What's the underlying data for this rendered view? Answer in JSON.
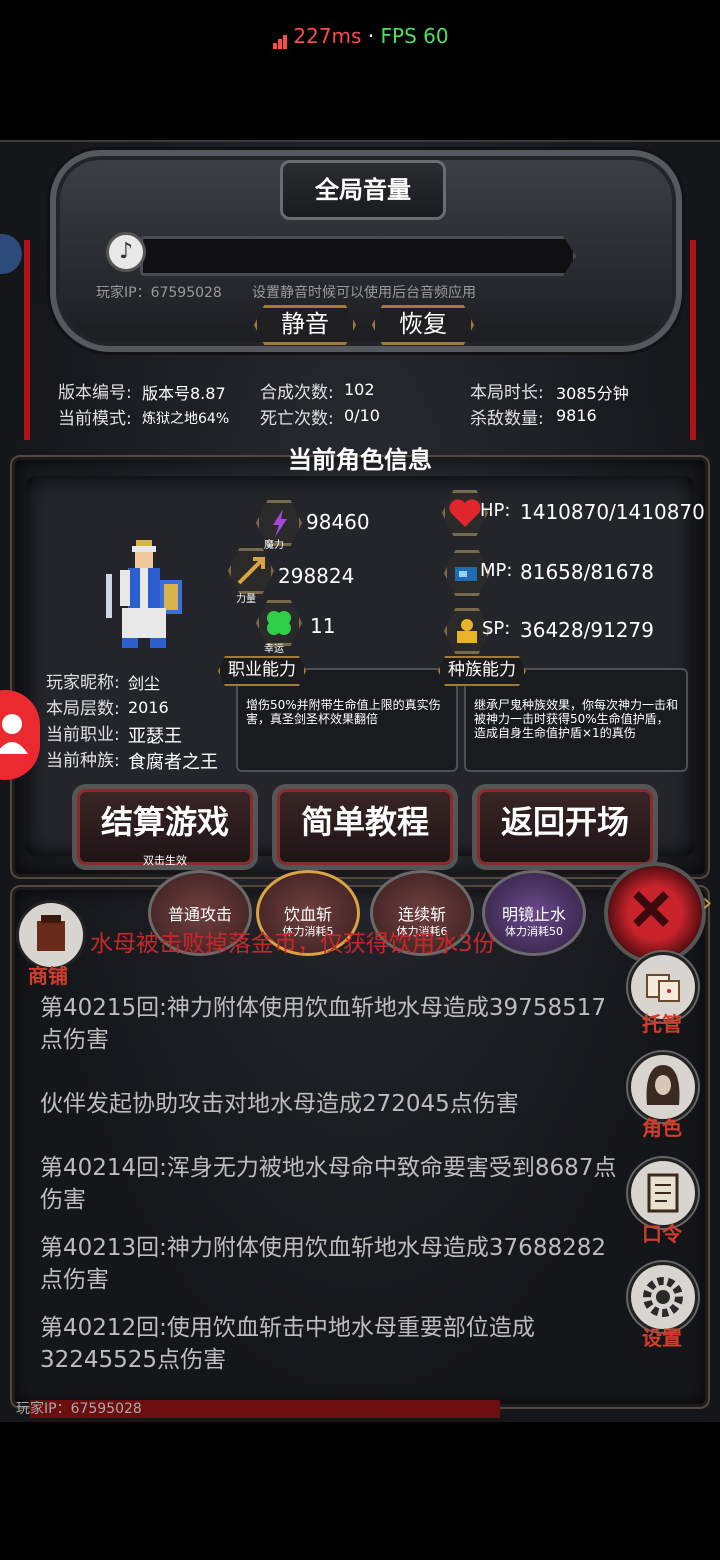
{
  "status_bar": {
    "ping": "227ms",
    "separator": " · ",
    "fps": "FPS 60"
  },
  "volume_panel": {
    "title": "全局音量",
    "player_ip": "玩家IP：67595028",
    "hint": "设置静音时候可以使用后台音频应用",
    "mute_label": "静音",
    "restore_label": "恢复",
    "speaker_icon": "speaker-icon"
  },
  "game_info": {
    "version_label": "版本编号:",
    "version_value": "版本号8.87",
    "mode_label": "当前模式:",
    "mode_value": "炼狱之地64%",
    "synth_label": "合成次数:",
    "synth_value": "102",
    "death_label": "死亡次数:",
    "death_value": "0/10",
    "duration_label": "本局时长:",
    "duration_value": "3085分钟",
    "kills_label": "杀敌数量:",
    "kills_value": "9816"
  },
  "character": {
    "section_title": "当前角色信息",
    "magic_value": "98460",
    "magic_label": "魔力",
    "strength_value": "298824",
    "strength_label": "力量",
    "luck_value": "11",
    "luck_label": "幸运",
    "hp_label": "HP:",
    "hp_value": "1410870/1410870",
    "mp_label": "MP:",
    "mp_value": "81658/81678",
    "sp_label": "SP:",
    "sp_value": "36428/91279",
    "nickname_label": "玩家昵称:",
    "nickname_value": "剑尘",
    "floor_label": "本局层数:",
    "floor_value": "2016",
    "class_label": "当前职业:",
    "class_value": "亚瑟王",
    "race_label": "当前种族:",
    "race_value": "食腐者之王",
    "class_ability_tag": "职业能力",
    "class_ability_text": "增伤50%并附带生命值上限的真实伤害，真圣剑圣杯效果翻倍",
    "race_ability_tag": "种族能力",
    "race_ability_text": "继承尸鬼种族效果，你每次神力一击和被神力一击时获得50%生命值护盾，造成自身生命值护盾×1的真伤"
  },
  "actions": {
    "settle_label": "结算游戏",
    "settle_sub": "双击生效",
    "tutorial_label": "简单教程",
    "return_label": "返回开场"
  },
  "skills": [
    {
      "name": "普通攻击",
      "cost": ""
    },
    {
      "name": "饮血斩",
      "cost": "体力消耗5"
    },
    {
      "name": "连续斩",
      "cost": "体力消耗6"
    },
    {
      "name": "明镜止水",
      "cost": "体力消耗50"
    }
  ],
  "side_menu": {
    "shop_label": "商铺",
    "auto_label": "托管",
    "role_label": "角色",
    "code_label": "口令",
    "settings_label": "设置"
  },
  "log": {
    "partial_red": "水母被击败掉落金币，仅获得饮用水3份",
    "entries": [
      "第40215回:神力附体使用饮血斩地水母造成39758517点伤害",
      "伙伴发起协助攻击对地水母造成272045点伤害",
      "第40214回:浑身无力被地水母命中致命要害受到8687点伤害",
      "第40213回:神力附体使用饮血斩地水母造成37688282点伤害",
      "第40212回:使用饮血斩击中地水母重要部位造成32245525点伤害"
    ]
  },
  "footer": {
    "player_ip": "玩家IP：67595028"
  },
  "colors": {
    "accent_red": "#c7272b",
    "gold_border": "#a07a3a",
    "ping": "#ff4a4a",
    "fps": "#4fe05a"
  }
}
